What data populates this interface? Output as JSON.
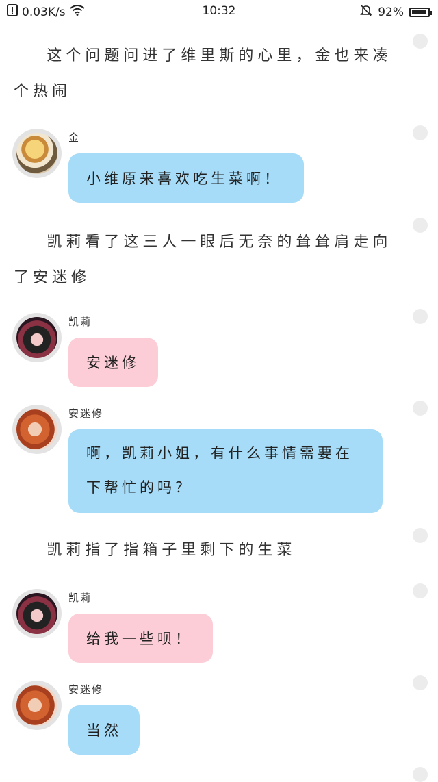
{
  "status_bar": {
    "net_speed": "0.03K/s",
    "time": "10:32",
    "battery_pct": "92%",
    "battery_level": 0.92
  },
  "narration": [
    "这个问题问进了维里斯的心里，金也来凑个热闹",
    "凯莉看了这三人一眼后无奈的耸耸肩走向了安迷修",
    "凯莉指了指箱子里剩下的生菜"
  ],
  "messages": [
    {
      "sender": "金",
      "text": "小维原来喜欢吃生菜啊！",
      "color": "#a6dcf8",
      "avatar": "jin-avatar"
    },
    {
      "sender": "凯莉",
      "text": "安迷修",
      "color": "#fccdd7",
      "avatar": "kaili-avatar"
    },
    {
      "sender": "安迷修",
      "text": "啊，凯莉小姐，有什么事情需要在下帮忙的吗？",
      "color": "#a6dcf8",
      "avatar": "anmixiu-avatar"
    },
    {
      "sender": "凯莉",
      "text": "给我一些呗！",
      "color": "#fccdd7",
      "avatar": "kaili-avatar"
    },
    {
      "sender": "安迷修",
      "text": "当然",
      "color": "#a6dcf8",
      "avatar": "anmixiu-avatar"
    }
  ],
  "icons": {
    "notification": "alert-box-icon",
    "wifi": "wifi-icon",
    "mute": "bell-off-icon",
    "battery": "battery-icon",
    "rail": "scroll-dot-icon"
  }
}
